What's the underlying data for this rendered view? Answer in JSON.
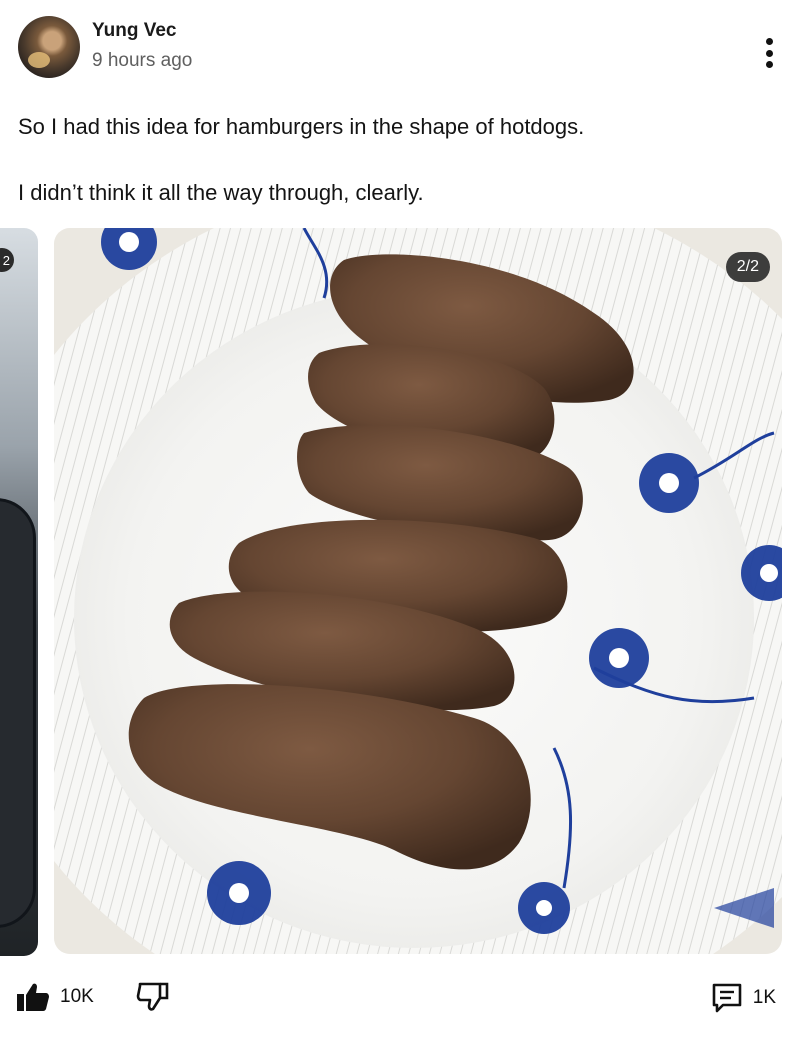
{
  "post": {
    "author": "Yung Vec",
    "time_ago": "9 hours ago",
    "text_line1": "So I had this idea for hamburgers in the shape of hotdogs.",
    "text_line2": "I didn’t think it all the way through, clearly."
  },
  "gallery": {
    "counter": "2/2",
    "prev_counter": "2",
    "image_description_icons": [
      "plate-icon",
      "meat-patty"
    ]
  },
  "actions": {
    "likes": "10K",
    "comments": "1K",
    "icons": [
      "thumbs-up-icon",
      "thumbs-down-icon",
      "comment-icon",
      "more-vertical-icon"
    ]
  },
  "colors": {
    "plate_blue": "#1f3f9c",
    "meat_brown": "#6b4a34",
    "text": "#111111",
    "muted": "#5f5f5f"
  }
}
